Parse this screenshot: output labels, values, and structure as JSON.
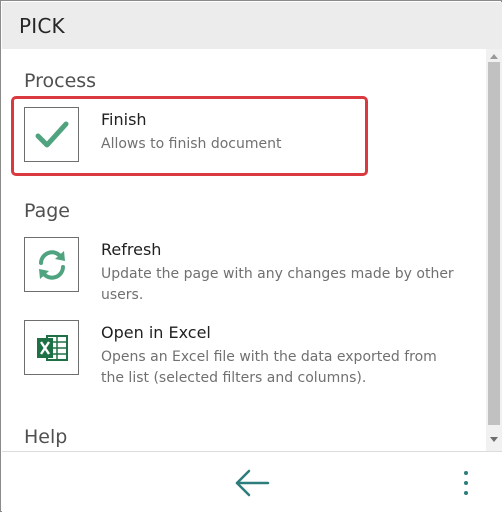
{
  "header": {
    "title": "PICK"
  },
  "sections": [
    {
      "title": "Process",
      "actions": [
        {
          "label": "Finish",
          "description": "Allows to finish document",
          "icon": "check-icon",
          "selected": true
        }
      ]
    },
    {
      "title": "Page",
      "actions": [
        {
          "label": "Refresh",
          "description": "Update the page with any changes made by other users.",
          "icon": "refresh-icon"
        },
        {
          "label": "Open in Excel",
          "description": "Opens an Excel file with the data exported from the list (selected filters and columns).",
          "icon": "excel-icon"
        }
      ]
    },
    {
      "title": "Help",
      "actions": []
    }
  ],
  "footer": {
    "back_icon": "back-arrow-icon",
    "more_icon": "more-vertical-icon"
  },
  "colors": {
    "accent": "#2e7d7d",
    "check": "#4fa37f",
    "excel": "#1e7145",
    "highlight": "#d9393f",
    "header_bg": "#ececec"
  }
}
